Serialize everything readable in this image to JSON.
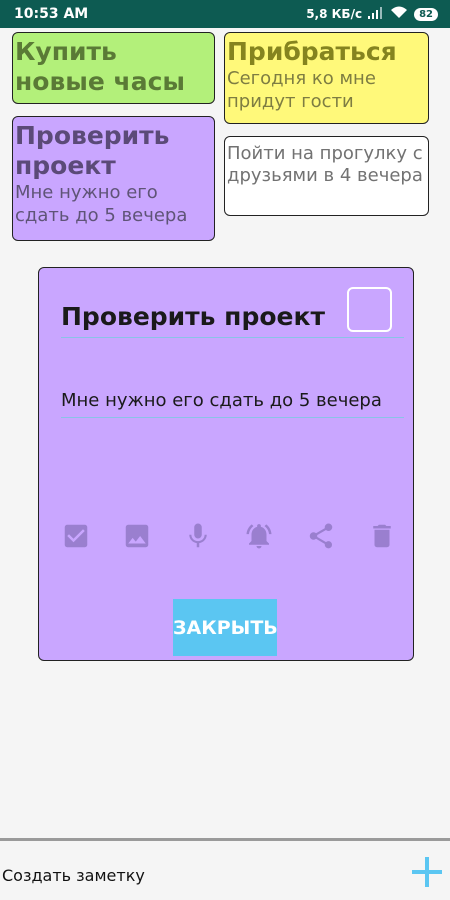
{
  "status_bar": {
    "time": "10:53 AM",
    "speed": "5,8 КБ/с",
    "battery": "82"
  },
  "notes": [
    {
      "title": "Купить новые часы",
      "body": "",
      "color": "#b3f07a"
    },
    {
      "title": "Прибраться",
      "body": "Сегодня ко мне придут гости",
      "color": "#fff97a"
    },
    {
      "title": "Проверить проект",
      "body": "Мне нужно его сдать до 5 вечера",
      "color": "#c9a6ff"
    },
    {
      "title": "",
      "body": "Пойти на прогулку с друзьями в 4 вечера",
      "color": "#ffffff"
    }
  ],
  "dialog": {
    "title": "Проверить проект",
    "text": "Мне нужно его сдать до 5 вечера",
    "checked": false,
    "color": "#c9a6ff",
    "tools": [
      "checkbox-icon",
      "image-icon",
      "microphone-icon",
      "bell-icon",
      "share-icon",
      "delete-icon"
    ],
    "close_label": "ЗАКРЫТЬ"
  },
  "bottom_bar": {
    "create_label": "Создать заметку",
    "add_icon": "plus-icon",
    "accent": "#5bc6f2"
  }
}
